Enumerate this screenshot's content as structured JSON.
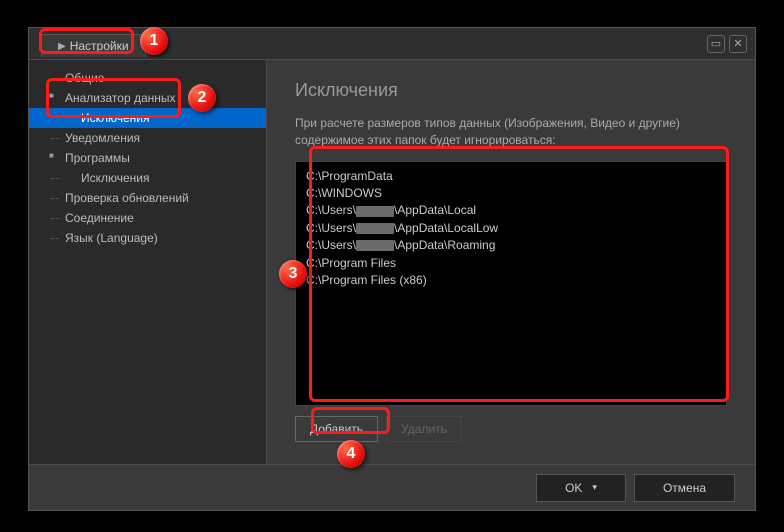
{
  "titlebar": {
    "tab_label": "Настройки"
  },
  "sidebar": {
    "items": [
      {
        "label": "Общие"
      },
      {
        "label": "Анализатор данных"
      },
      {
        "label": "Исключения"
      },
      {
        "label": "Уведомления"
      },
      {
        "label": "Программы"
      },
      {
        "label": "Исключения"
      },
      {
        "label": "Проверка обновлений"
      },
      {
        "label": "Соединение"
      },
      {
        "label": "Язык (Language)"
      }
    ]
  },
  "main": {
    "title": "Исключения",
    "description": "При расчете размеров типов данных (Изображения, Видео и другие) содержимое этих папок будет игнорироваться:",
    "list": [
      "C:\\ProgramData",
      "C:\\WINDOWS",
      "C:\\Users\\[redacted]\\AppData\\Local",
      "C:\\Users\\[redacted]\\AppData\\LocalLow",
      "C:\\Users\\[redacted]\\AppData\\Roaming",
      "C:\\Program Files",
      "C:\\Program Files (x86)"
    ],
    "add_label": "Добавить",
    "delete_label": "Удалить"
  },
  "footer": {
    "ok_label": "OK",
    "cancel_label": "Отмена"
  },
  "badges": [
    "1",
    "2",
    "3",
    "4"
  ]
}
